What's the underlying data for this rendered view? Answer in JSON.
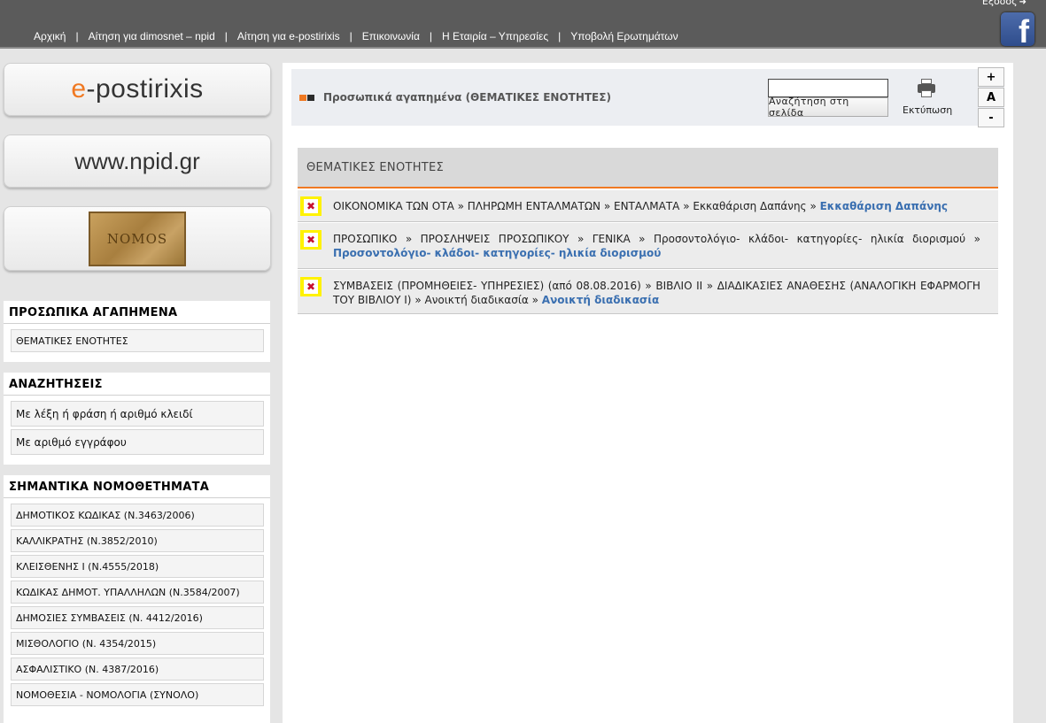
{
  "topbar": {
    "logout_label": "Έξοδος",
    "facebook_letter": "f",
    "nav": [
      "Αρχική",
      "Αίτηση για dimosnet – npid",
      "Αίτηση για e-postirixis",
      "Επικοινωνία",
      "Η Εταιρία – Υπηρεσίες",
      "Υποβολή Ερωτημάτων"
    ],
    "separator": "|"
  },
  "sidebar": {
    "logo_epostirixis": {
      "prefix": "e",
      "rest": "-postirixis"
    },
    "logo_npid": "www.npid.gr",
    "logo_nomos": "NOMOS",
    "favorites": {
      "title": "ΠΡΟΣΩΠΙΚΑ ΑΓΑΠΗΜΕΝΑ",
      "items": [
        "ΘΕΜΑΤΙΚΕΣ ΕΝΟΤΗΤΕΣ"
      ]
    },
    "searches": {
      "title": "ΑΝΑΖΗΤΗΣΕΙΣ",
      "items": [
        "Με λέξη ή φράση ή αριθμό κλειδί",
        "Με αριθμό εγγράφου"
      ]
    },
    "laws": {
      "title": "ΣΗΜΑΝΤΙΚΑ ΝΟΜΟΘΕΤΗΜΑΤΑ",
      "items": [
        "ΔΗΜΟΤΙΚΟΣ ΚΩΔΙΚΑΣ (Ν.3463/2006)",
        "ΚΑΛΛΙΚΡΑΤΗΣ (Ν.3852/2010)",
        "ΚΛΕΙΣΘΕΝΗΣ Ι (Ν.4555/2018)",
        "ΚΩΔΙΚΑΣ ΔΗΜΟΤ. ΥΠΑΛΛΗΛΩΝ (Ν.3584/2007)",
        "ΔΗΜΟΣΙΕΣ ΣΥΜΒΑΣΕΙΣ (Ν. 4412/2016)",
        "ΜΙΣΘΟΛΟΓΙΟ (Ν. 4354/2015)",
        "ΑΣΦΑΛΙΣΤΙΚΟ (Ν. 4387/2016)",
        "ΝΟΜΟΘΕΣΙΑ - ΝΟΜΟΛΟΓΙΑ (ΣΥΝΟΛΟ)"
      ]
    }
  },
  "main": {
    "header_title": "Προσωπικά αγαπημένα (ΘΕΜΑΤΙΚΕΣ ΕΝΟΤΗΤΕΣ)",
    "search_value": "",
    "search_button": "Αναζήτηση στη σελίδα",
    "print_label": "Εκτύπωση",
    "font_buttons": [
      "+",
      "A",
      "-"
    ],
    "section_title": "ΘΕΜΑΤΙΚΕΣ ΕΝΟΤΗΤΕΣ",
    "delete_glyph": "✖",
    "crumb_sep": "»",
    "favorites": [
      {
        "path": [
          "ΟΙΚΟΝΟΜΙΚΑ ΤΩΝ ΟΤΑ",
          "ΠΛΗΡΩΜΗ ΕΝΤΑΛΜΑΤΩΝ",
          "ΕΝΤΑΛΜΑΤΑ",
          "Εκκαθάριση Δαπάνης"
        ],
        "title": "Εκκαθάριση Δαπάνης"
      },
      {
        "path": [
          "ΠΡΟΣΩΠΙΚΟ",
          "ΠΡΟΣΛΗΨΕΙΣ ΠΡΟΣΩΠΙΚΟΥ",
          "ΓΕΝΙΚΑ",
          "Προσοντολόγιο- κλάδοι- κατηγορίες- ηλικία διορισμού"
        ],
        "title": "Προσοντολόγιο- κλάδοι- κατηγορίες- ηλικία διορισμού"
      },
      {
        "path": [
          "ΣΥΜΒΑΣΕΙΣ (ΠΡΟΜΗΘΕΙΕΣ- ΥΠΗΡΕΣΙΕΣ) (από 08.08.2016)",
          "ΒΙΒΛΙΟ ΙΙ",
          "ΔΙΑΔΙΚΑΣΙΕΣ ΑΝΑΘΕΣΗΣ (ΑΝΑΛΟΓΙΚΗ ΕΦΑΡΜΟΓΗ ΤΟΥ ΒΙΒΛΙΟΥ Ι)",
          "Ανοικτή διαδικασία"
        ],
        "title": "Ανοικτή διαδικασία"
      }
    ]
  }
}
